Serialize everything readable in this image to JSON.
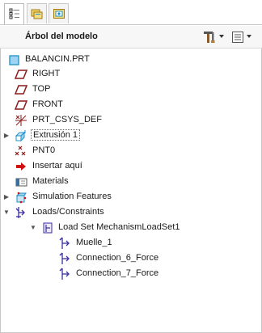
{
  "tabs": [
    {
      "name": "tab-model-tree",
      "icon": "model-tree-icon"
    },
    {
      "name": "tab-folder-browser",
      "icon": "folder-icon"
    },
    {
      "name": "tab-favorites",
      "icon": "favorites-icon"
    }
  ],
  "header": {
    "title": "Árbol del modelo",
    "tools_icon": "settings-tools-icon",
    "show_icon": "show-menu-icon"
  },
  "tree": [
    {
      "label": "BALANCIN.PRT",
      "icon": "part-icon",
      "level": 0,
      "expander": ""
    },
    {
      "label": "RIGHT",
      "icon": "datum-plane-icon",
      "level": 1,
      "expander": ""
    },
    {
      "label": "TOP",
      "icon": "datum-plane-icon",
      "level": 1,
      "expander": ""
    },
    {
      "label": "FRONT",
      "icon": "datum-plane-icon",
      "level": 1,
      "expander": ""
    },
    {
      "label": "PRT_CSYS_DEF",
      "icon": "coordinate-system-icon",
      "level": 1,
      "expander": ""
    },
    {
      "label": "Extrusión 1",
      "icon": "extrude-icon",
      "level": 1,
      "expander": "collapsed"
    },
    {
      "label": "PNT0",
      "icon": "datum-point-icon",
      "level": 1,
      "expander": ""
    },
    {
      "label": "Insertar aquí",
      "icon": "insert-here-arrow-icon",
      "level": 1,
      "expander": ""
    },
    {
      "label": "Materials",
      "icon": "materials-icon",
      "level": 1,
      "expander": ""
    },
    {
      "label": "Simulation Features",
      "icon": "simulation-features-icon",
      "level": 1,
      "expander": "collapsed"
    },
    {
      "label": "Loads/Constraints",
      "icon": "loads-constraints-icon",
      "level": 1,
      "expander": "expanded"
    },
    {
      "label": "Load Set MechanismLoadSet1",
      "icon": "load-set-icon",
      "level": 2,
      "expander": "expanded"
    },
    {
      "label": "Muelle_1",
      "icon": "force-icon",
      "level": 3,
      "expander": ""
    },
    {
      "label": "Connection_6_Force",
      "icon": "force-icon",
      "level": 3,
      "expander": ""
    },
    {
      "label": "Connection_7_Force",
      "icon": "force-icon",
      "level": 3,
      "expander": ""
    }
  ],
  "colors": {
    "part": "#1e90c8",
    "datum": "#8b1a1a",
    "insert_arrow": "#d01010",
    "load_icon": "#3a2fa0",
    "expander": "#555555"
  }
}
